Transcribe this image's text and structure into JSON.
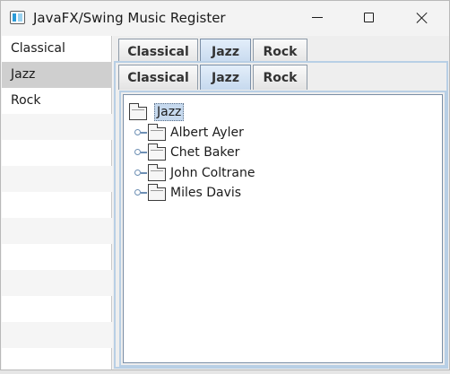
{
  "window": {
    "title": "JavaFX/Swing Music Register"
  },
  "sidebar": {
    "items": [
      {
        "label": "Classical"
      },
      {
        "label": "Jazz"
      },
      {
        "label": "Rock"
      }
    ],
    "selected": "Jazz"
  },
  "tabs_outer": {
    "items": [
      {
        "label": "Classical"
      },
      {
        "label": "Jazz"
      },
      {
        "label": "Rock"
      }
    ],
    "selected": "Jazz"
  },
  "tabs_inner": {
    "items": [
      {
        "label": "Classical"
      },
      {
        "label": "Jazz"
      },
      {
        "label": "Rock"
      }
    ],
    "selected": "Jazz"
  },
  "tree": {
    "root": "Jazz",
    "children": [
      {
        "label": "Albert Ayler"
      },
      {
        "label": "Chet Baker"
      },
      {
        "label": "John Coltrane"
      },
      {
        "label": "Miles Davis"
      }
    ]
  },
  "colors": {
    "selection": "#c6d9ee",
    "tab_active": "#c6d9ee",
    "list_selected": "#cfcfcf"
  }
}
